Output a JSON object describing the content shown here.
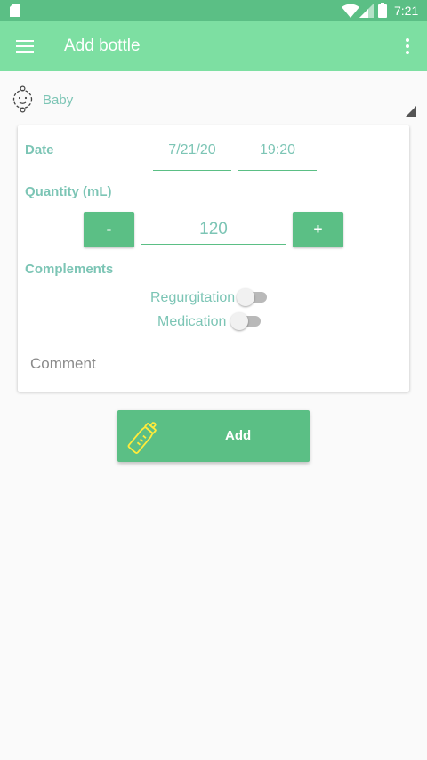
{
  "status_bar": {
    "time": "7:21",
    "background": "#5bbf85"
  },
  "app_bar": {
    "title": "Add bottle",
    "background": "#7ddfa2",
    "menu_icon": "menu-icon",
    "overflow_icon": "more-vert-icon"
  },
  "baby_selector": {
    "icon": "baby-face-icon",
    "selected": "Baby"
  },
  "form": {
    "date_label": "Date",
    "date_value": "7/21/20",
    "time_value": "19:20",
    "quantity_label": "Quantity (mL)",
    "quantity_value": "120",
    "decrement_label": "-",
    "increment_label": "+",
    "complements_label": "Complements",
    "regurgitation_label": "Regurgitation",
    "regurgitation_on": false,
    "medication_label": "Medication",
    "medication_on": false,
    "comment_placeholder": "Comment"
  },
  "add_button": {
    "label": "Add",
    "icon": "baby-bottle-icon"
  },
  "colors": {
    "accent": "#5bbf85",
    "text_accent": "#7cc5b5",
    "bottle_icon": "#ffeb3b"
  }
}
